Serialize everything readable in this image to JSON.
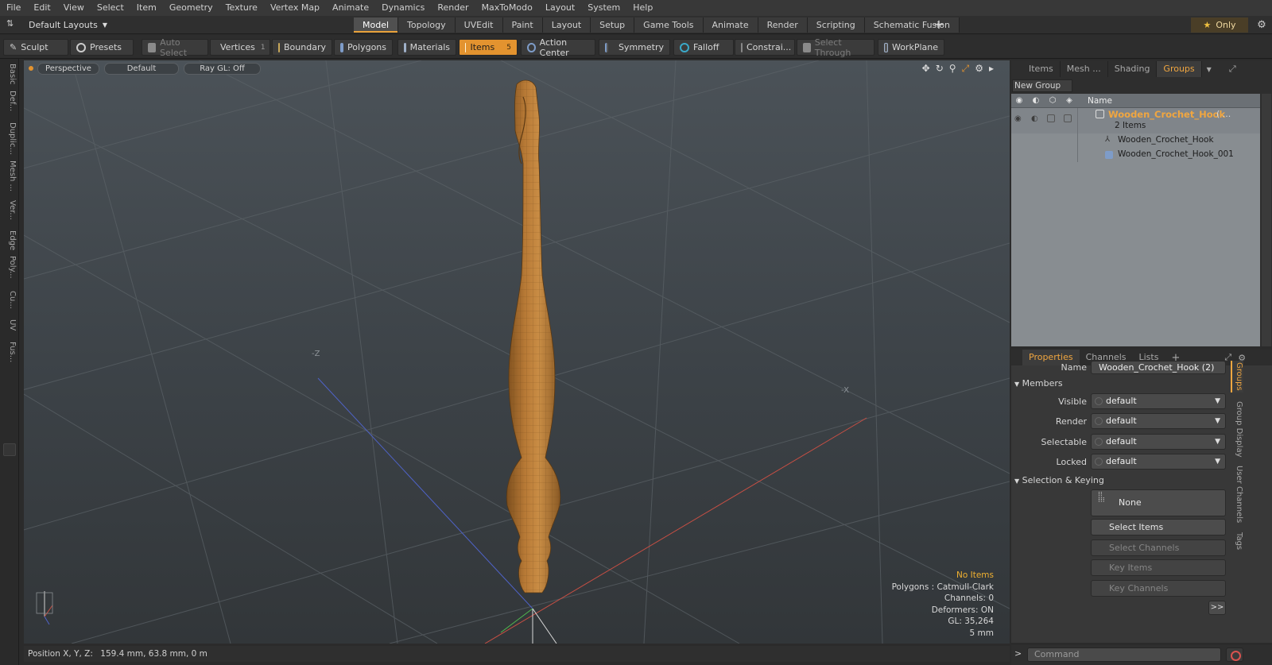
{
  "menu": [
    "File",
    "Edit",
    "View",
    "Select",
    "Item",
    "Geometry",
    "Texture",
    "Vertex Map",
    "Animate",
    "Dynamics",
    "Render",
    "MaxToModo",
    "Layout",
    "System",
    "Help"
  ],
  "layout_selector": "Default Layouts",
  "layout_tabs": [
    "Model",
    "Topology",
    "UVEdit",
    "Paint",
    "Layout",
    "Setup",
    "Game Tools",
    "Animate",
    "Render",
    "Scripting",
    "Schematic Fusion"
  ],
  "active_layout_tab": "Model",
  "only_button": "Only",
  "toolbar": {
    "sculpt": "Sculpt",
    "presets": "Presets",
    "auto_select": "Auto Select",
    "vertices": "Vertices",
    "vertices_count": "1",
    "boundary": "Boundary",
    "polygons": "Polygons",
    "materials": "Materials",
    "items": "Items",
    "items_count": "5",
    "action_center": "Action Center",
    "symmetry": "Symmetry",
    "falloff": "Falloff",
    "constraints": "Constrai...",
    "select_through": "Select Through",
    "workplane": "WorkPlane"
  },
  "left_tabs": [
    "Basic",
    "Def...",
    "Duplic...",
    "Mesh ...",
    "Ver...",
    "Edge",
    "Poly...",
    "Cu...",
    "UV",
    "Fus..."
  ],
  "viewport": {
    "view_mode": "Perspective",
    "shading": "Default",
    "raygl": "Ray GL: Off",
    "axis_label_z": "-Z",
    "axis_label_x": "-X",
    "stats": [
      "No Items",
      "Polygons : Catmull-Clark",
      "Channels: 0",
      "Deformers: ON",
      "GL: 35,264",
      "5 mm"
    ]
  },
  "statusbar": {
    "label": "Position X, Y, Z:",
    "value": "159.4 mm, 63.8 mm, 0 m"
  },
  "groups_panel": {
    "tabs": [
      "Items",
      "Mesh ...",
      "Shading",
      "Groups"
    ],
    "active_tab": "Groups",
    "new_group": "New Group",
    "name_header": "Name",
    "group_name": "Wooden_Crochet_Hook",
    "group_suffix": "( ...",
    "group_count": "2 Items",
    "children": [
      "Wooden_Crochet_Hook",
      "Wooden_Crochet_Hook_001"
    ]
  },
  "properties_panel": {
    "tabs": [
      "Properties",
      "Channels",
      "Lists"
    ],
    "active_tab": "Properties",
    "name_label": "Name",
    "name_value": "Wooden_Crochet_Hook (2)",
    "members_section": "Members",
    "fields": [
      {
        "label": "Visible",
        "value": "default"
      },
      {
        "label": "Render",
        "value": "default"
      },
      {
        "label": "Selectable",
        "value": "default"
      },
      {
        "label": "Locked",
        "value": "default"
      }
    ],
    "keying_section": "Selection & Keying",
    "none_label": "None",
    "select_items": "Select Items",
    "select_channels": "Select Channels",
    "key_items": "Key Items",
    "key_channels": "Key Channels",
    "more": ">>",
    "side_tabs": [
      "Groups",
      "Group Display",
      "User Channels",
      "Tags"
    ]
  },
  "command": {
    "prompt": ">",
    "placeholder": "Command"
  },
  "colors": {
    "accent": "#e3932f",
    "wood": "#b87a36",
    "group_name": "#f0a640"
  }
}
